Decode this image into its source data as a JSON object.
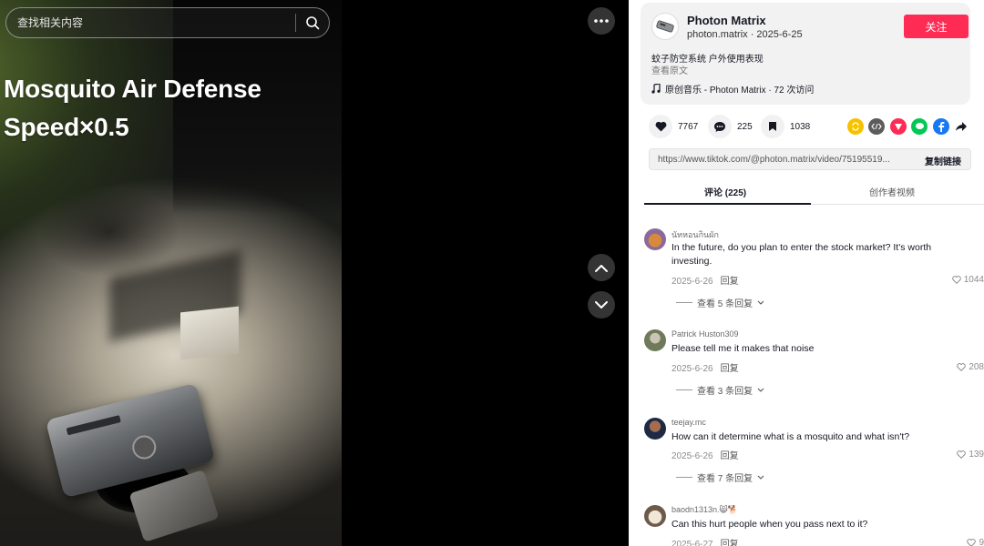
{
  "search": {
    "placeholder": "查找相关内容"
  },
  "video": {
    "overlay_line1": "Mosquito Air Defense",
    "overlay_line2": "Speed×0.5"
  },
  "author": {
    "name": "Photon Matrix",
    "handle_date": "photon.matrix · 2025-6-25",
    "follow_label": "关注",
    "description": "蚊子防空系统 户外使用表现",
    "see_original": "查看原文",
    "music": "原创音乐 - Photon Matrix · 72 次访问"
  },
  "actions": {
    "likes": "7767",
    "comments": "225",
    "saves": "1038"
  },
  "share_icons": [
    "repost-icon",
    "embed-icon",
    "send-icon",
    "line-icon",
    "facebook-icon",
    "share-arrow-icon"
  ],
  "link": {
    "url": "https://www.tiktok.com/@photon.matrix/video/75195519...",
    "copy_label": "复制链接"
  },
  "tabs": {
    "comments": "评论 (225)",
    "creator_videos": "创作者视频"
  },
  "comments": [
    {
      "user": "นัทหอนกินผัก",
      "text": "In the future, do you plan to enter the stock market? It's worth investing.",
      "date": "2025-6-26",
      "reply": "回复",
      "likes": "1044",
      "view_replies": "查看 5 条回复"
    },
    {
      "user": "Patrick Huston309",
      "text": "Please tell me it makes that noise",
      "date": "2025-6-26",
      "reply": "回复",
      "likes": "208",
      "view_replies": "查看 3 条回复"
    },
    {
      "user": "teejay.mc",
      "text": "How can it determine what is a mosquito and what isn't?",
      "date": "2025-6-26",
      "reply": "回复",
      "likes": "139",
      "view_replies": "查看 7 条回复"
    },
    {
      "user": "baodn1313n.😸🐕",
      "text": "Can this hurt people when you pass next to it?",
      "date": "2025-6-27",
      "reply": "回复",
      "likes": "9",
      "view_replies": ""
    }
  ]
}
